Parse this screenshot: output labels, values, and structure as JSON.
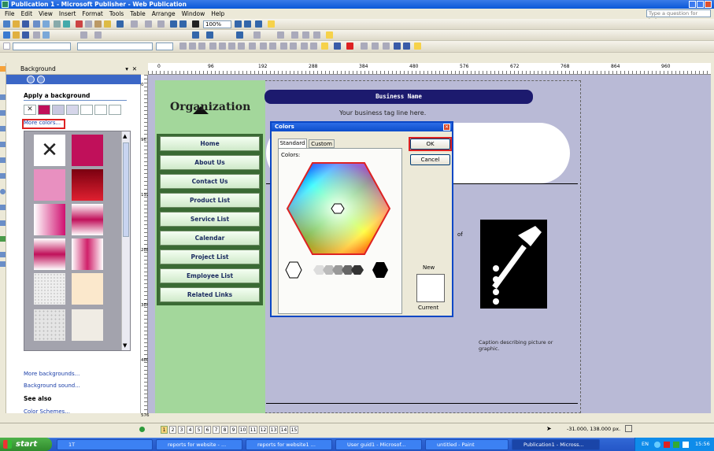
{
  "window": {
    "title": "Publication 1 - Microsoft Publisher - Web Publication"
  },
  "menu": [
    "File",
    "Edit",
    "View",
    "Insert",
    "Format",
    "Tools",
    "Table",
    "Arrange",
    "Window",
    "Help"
  ],
  "ask_placeholder": "Type a question for help",
  "toolbar": {
    "zoom": "100%"
  },
  "taskpane": {
    "title": "Background",
    "apply_heading": "Apply a background",
    "more_colors": "More colors...",
    "more_backgrounds": "More backgrounds...",
    "background_sound": "Background sound...",
    "see_also": "See also",
    "color_schemes": "Color Schemes..."
  },
  "ruler": {
    "h_marks": [
      "0",
      "96",
      "192",
      "288",
      "384",
      "480",
      "576",
      "672",
      "768",
      "864",
      "960"
    ],
    "v_marks": [
      "0",
      "96",
      "192",
      "288",
      "384",
      "480",
      "576"
    ]
  },
  "site": {
    "org": "Organization",
    "business_name": "Business Name",
    "tagline": "Your business tag line here.",
    "nav": [
      "Home",
      "About Us",
      "Contact Us",
      "Product List",
      "Service List",
      "Calendar",
      "Project List",
      "Employee List",
      "Related Links"
    ],
    "caption": "Caption describing picture or graphic.",
    "of_text": "of"
  },
  "dialog": {
    "title": "Colors",
    "tab_standard": "Standard",
    "tab_custom": "Custom",
    "colors_label": "Colors:",
    "ok": "OK",
    "cancel": "Cancel",
    "new_label": "New",
    "current_label": "Current"
  },
  "status": {
    "pages": [
      "1",
      "2",
      "3",
      "4",
      "5",
      "6",
      "7",
      "8",
      "9",
      "10",
      "11",
      "12",
      "13",
      "14",
      "15"
    ],
    "coords": "-31.000, 138.000 px."
  },
  "taskbar": {
    "start": "start",
    "tasks": [
      {
        "label": "1T",
        "active": false
      },
      {
        "label": "reports for website - ...",
        "active": false
      },
      {
        "label": "reports for website1 ...",
        "active": false
      },
      {
        "label": "User guid1 - Microsof...",
        "active": false
      },
      {
        "label": "untitled - Paint",
        "active": false
      },
      {
        "label": "Publication1 - Micross...",
        "active": true
      }
    ],
    "lang": "EN",
    "clock": "15:56"
  }
}
